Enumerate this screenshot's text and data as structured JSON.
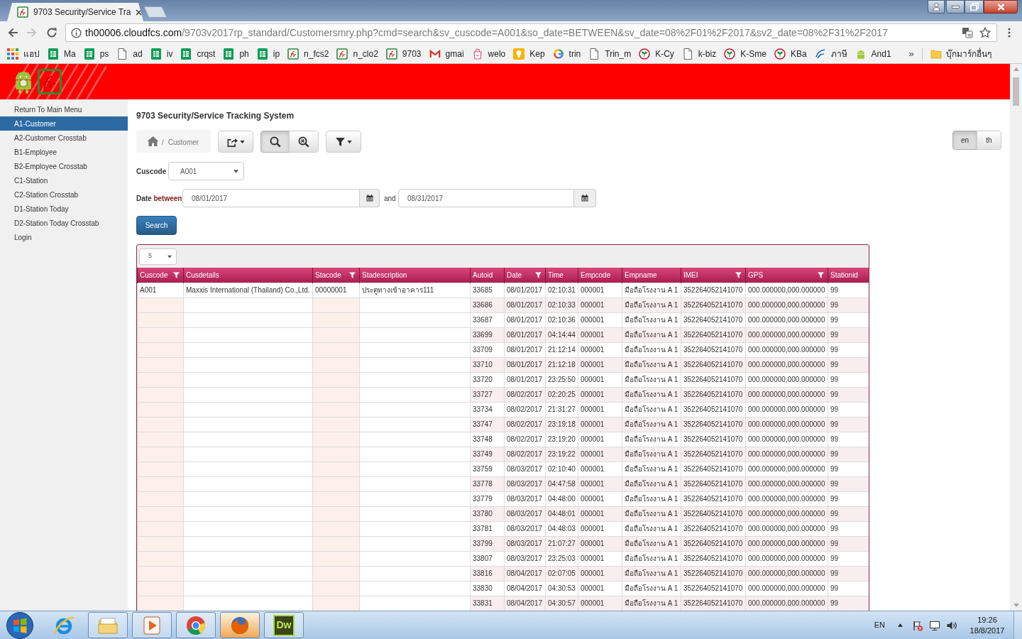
{
  "browser": {
    "tab": {
      "title": "9703 Security/Service Tra"
    },
    "navigation": {
      "back_enabled": true,
      "forward_enabled": false
    },
    "address": {
      "host": "th00006.cloudfcs.com",
      "path": "/9703v2017rp_standard/Customersmry.php?cmd=search&sv_cuscode=A001&so_date=BETWEEN&sv_date=08%2F01%2F2017&sv2_date=08%2F31%2F2017"
    },
    "bookmarks": [
      {
        "label": "แอป",
        "kind": "apps"
      },
      {
        "label": "Ma",
        "kind": "sheet"
      },
      {
        "label": "ps",
        "kind": "sheet"
      },
      {
        "label": "ad",
        "kind": "page"
      },
      {
        "label": "iv",
        "kind": "sheet"
      },
      {
        "label": "crqst",
        "kind": "sheet"
      },
      {
        "label": "ph",
        "kind": "sheet"
      },
      {
        "label": "ip",
        "kind": "sheet"
      },
      {
        "label": "n_fcs2",
        "kind": "fc"
      },
      {
        "label": "n_clo2",
        "kind": "fc"
      },
      {
        "label": "9703",
        "kind": "fc"
      },
      {
        "label": "gmai",
        "kind": "mail"
      },
      {
        "label": "welo",
        "kind": "bag"
      },
      {
        "label": "Kep",
        "kind": "bulb"
      },
      {
        "label": "trin",
        "kind": "ring"
      },
      {
        "label": "Trin_m",
        "kind": "page"
      },
      {
        "label": "K-Cy",
        "kind": "bank"
      },
      {
        "label": "k-biz",
        "kind": "page"
      },
      {
        "label": "K-Sme",
        "kind": "bank"
      },
      {
        "label": "KBa",
        "kind": "bank"
      },
      {
        "label": "ภาษี",
        "kind": "swirl"
      },
      {
        "label": "And1",
        "kind": "robot"
      }
    ],
    "bookmarks_overflow": "»",
    "other_bookmarks": "บุ๊กมาร์กอื่นๆ"
  },
  "sidebar": {
    "items": [
      {
        "label": "Return To Main Menu",
        "selected": false
      },
      {
        "label": "A1-Customer",
        "selected": true
      },
      {
        "label": "A2-Customer Crosstab",
        "selected": false
      },
      {
        "label": "B1-Employee",
        "selected": false
      },
      {
        "label": "B2-Employee Crosstab",
        "selected": false
      },
      {
        "label": "C1-Station",
        "selected": false
      },
      {
        "label": "C2-Station Crosstab",
        "selected": false
      },
      {
        "label": "D1-Station Today",
        "selected": false
      },
      {
        "label": "D2-Station Today Crosstab",
        "selected": false
      },
      {
        "label": "Login",
        "selected": false
      }
    ]
  },
  "page": {
    "title": "9703 Security/Service Tracking System",
    "breadcrumb": {
      "separator": "/",
      "current": "Customer"
    },
    "search_buttons": [
      {
        "kind": "search",
        "active": true
      },
      {
        "kind": "reset",
        "active": false
      }
    ],
    "languages": [
      {
        "label": "en",
        "selected": true
      },
      {
        "label": "th",
        "selected": false
      }
    ],
    "filters": {
      "cuscode_label": "Cuscode",
      "cuscode": "A001",
      "date_label": "Date",
      "date_operator": "between",
      "date_from": "08/01/2017",
      "and_label": "and",
      "date_to": "08/31/2017",
      "search_button": "Search"
    },
    "table": {
      "page_size": "5",
      "columns": [
        {
          "label": "Cuscode",
          "filter": true,
          "kind": "group"
        },
        {
          "label": "Cusdetails",
          "filter": false,
          "kind": "group_detail"
        },
        {
          "label": "Stacode",
          "filter": true,
          "kind": "group"
        },
        {
          "label": "Stadescription",
          "filter": false,
          "kind": "group_detail"
        },
        {
          "label": "Autoid",
          "filter": false,
          "kind": "detail"
        },
        {
          "label": "Date",
          "filter": true,
          "kind": "detail"
        },
        {
          "label": "Time",
          "filter": false,
          "kind": "detail"
        },
        {
          "label": "Empcode",
          "filter": false,
          "kind": "detail"
        },
        {
          "label": "Empname",
          "filter": false,
          "kind": "detail"
        },
        {
          "label": "IMEI",
          "filter": true,
          "kind": "detail"
        },
        {
          "label": "GPS",
          "filter": true,
          "kind": "detail"
        },
        {
          "label": "Stationid",
          "filter": false,
          "kind": "detail"
        }
      ],
      "rows": [
        [
          "A001",
          "Maxxis International (Thailand) Co.,Ltd.",
          "00000001",
          "ประตูทางเข้าอาคาร111",
          "33685",
          "08/01/2017",
          "02:10:31",
          "000001",
          "มือถือโรงงาน A 1",
          "352264052141070",
          "000.000000,000.000000",
          "99"
        ],
        [
          null,
          null,
          null,
          null,
          "33686",
          "08/01/2017",
          "02:10:33",
          "000001",
          "มือถือโรงงาน A 1",
          "352264052141070",
          "000.000000,000.000000",
          "99"
        ],
        [
          null,
          null,
          null,
          null,
          "33687",
          "08/01/2017",
          "02:10:36",
          "000001",
          "มือถือโรงงาน A 1",
          "352264052141070",
          "000.000000,000.000000",
          "99"
        ],
        [
          null,
          null,
          null,
          null,
          "33699",
          "08/01/2017",
          "04:14:44",
          "000001",
          "มือถือโรงงาน A 1",
          "352264052141070",
          "000.000000,000.000000",
          "99"
        ],
        [
          null,
          null,
          null,
          null,
          "33709",
          "08/01/2017",
          "21:12:14",
          "000001",
          "มือถือโรงงาน A 1",
          "352264052141070",
          "000.000000,000.000000",
          "99"
        ],
        [
          null,
          null,
          null,
          null,
          "33710",
          "08/01/2017",
          "21:12:18",
          "000001",
          "มือถือโรงงาน A 1",
          "352264052141070",
          "000.000000,000.000000",
          "99"
        ],
        [
          null,
          null,
          null,
          null,
          "33720",
          "08/01/2017",
          "23:25:50",
          "000001",
          "มือถือโรงงาน A 1",
          "352264052141070",
          "000.000000,000.000000",
          "99"
        ],
        [
          null,
          null,
          null,
          null,
          "33727",
          "08/02/2017",
          "02:20:25",
          "000001",
          "มือถือโรงงาน A 1",
          "352264052141070",
          "000.000000,000.000000",
          "99"
        ],
        [
          null,
          null,
          null,
          null,
          "33734",
          "08/02/2017",
          "21:31:27",
          "000001",
          "มือถือโรงงาน A 1",
          "352264052141070",
          "000.000000,000.000000",
          "99"
        ],
        [
          null,
          null,
          null,
          null,
          "33747",
          "08/02/2017",
          "23:19:18",
          "000001",
          "มือถือโรงงาน A 1",
          "352264052141070",
          "000.000000,000.000000",
          "99"
        ],
        [
          null,
          null,
          null,
          null,
          "33748",
          "08/02/2017",
          "23:19:20",
          "000001",
          "มือถือโรงงาน A 1",
          "352264052141070",
          "000.000000,000.000000",
          "99"
        ],
        [
          null,
          null,
          null,
          null,
          "33749",
          "08/02/2017",
          "23:19:22",
          "000001",
          "มือถือโรงงาน A 1",
          "352264052141070",
          "000.000000,000.000000",
          "99"
        ],
        [
          null,
          null,
          null,
          null,
          "33759",
          "08/03/2017",
          "02:10:40",
          "000001",
          "มือถือโรงงาน A 1",
          "352264052141070",
          "000.000000,000.000000",
          "99"
        ],
        [
          null,
          null,
          null,
          null,
          "33778",
          "08/03/2017",
          "04:47:58",
          "000001",
          "มือถือโรงงาน A 1",
          "352264052141070",
          "000.000000,000.000000",
          "99"
        ],
        [
          null,
          null,
          null,
          null,
          "33779",
          "08/03/2017",
          "04:48:00",
          "000001",
          "มือถือโรงงาน A 1",
          "352264052141070",
          "000.000000,000.000000",
          "99"
        ],
        [
          null,
          null,
          null,
          null,
          "33780",
          "08/03/2017",
          "04:48:01",
          "000001",
          "มือถือโรงงาน A 1",
          "352264052141070",
          "000.000000,000.000000",
          "99"
        ],
        [
          null,
          null,
          null,
          null,
          "33781",
          "08/03/2017",
          "04:48:03",
          "000001",
          "มือถือโรงงาน A 1",
          "352264052141070",
          "000.000000,000.000000",
          "99"
        ],
        [
          null,
          null,
          null,
          null,
          "33799",
          "08/03/2017",
          "21:07:27",
          "000001",
          "มือถือโรงงาน A 1",
          "352264052141070",
          "000.000000,000.000000",
          "99"
        ],
        [
          null,
          null,
          null,
          null,
          "33807",
          "08/03/2017",
          "23:25:03",
          "000001",
          "มือถือโรงงาน A 1",
          "352264052141070",
          "000.000000,000.000000",
          "99"
        ],
        [
          null,
          null,
          null,
          null,
          "33816",
          "08/04/2017",
          "02:07:05",
          "000001",
          "มือถือโรงงาน A 1",
          "352264052141070",
          "000.000000,000.000000",
          "99"
        ],
        [
          null,
          null,
          null,
          null,
          "33830",
          "08/04/2017",
          "04:30:53",
          "000001",
          "มือถือโรงงาน A 1",
          "352264052141070",
          "000.000000,000.000000",
          "99"
        ],
        [
          null,
          null,
          null,
          null,
          "33831",
          "08/04/2017",
          "04:30:57",
          "000001",
          "มือถือโรงงาน A 1",
          "352264052141070",
          "000.000000,000.000000",
          "99"
        ]
      ]
    }
  },
  "taskbar": {
    "apps": [
      {
        "kind": "ie",
        "running": false,
        "active": false
      },
      {
        "kind": "explorer",
        "running": true,
        "active": false
      },
      {
        "kind": "media",
        "running": true,
        "active": false
      },
      {
        "kind": "chrome",
        "running": true,
        "active": false
      },
      {
        "kind": "firefox",
        "running": true,
        "active": true
      },
      {
        "kind": "dw",
        "label": "Dw",
        "running": true,
        "active": false
      }
    ],
    "language": "EN",
    "time": "19:26",
    "date": "18/8/2017"
  }
}
